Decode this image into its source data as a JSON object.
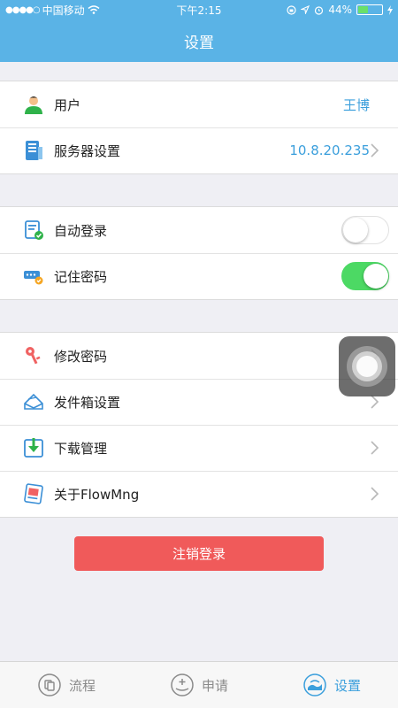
{
  "status_bar": {
    "carrier": "中国移动",
    "time": "下午2:15",
    "battery": "44%",
    "battery_level": 0.44
  },
  "header": {
    "title": "设置"
  },
  "groups": {
    "account": [
      {
        "label": "用户",
        "value": "王博",
        "icon": "user-icon"
      },
      {
        "label": "服务器设置",
        "value": "10.8.20.235",
        "icon": "server-icon"
      }
    ],
    "toggles": [
      {
        "label": "自动登录",
        "on": false,
        "icon": "auto-login-icon"
      },
      {
        "label": "记住密码",
        "on": true,
        "icon": "remember-password-icon"
      }
    ],
    "misc": [
      {
        "label": "修改密码",
        "icon": "key-icon"
      },
      {
        "label": "发件箱设置",
        "icon": "outbox-icon"
      },
      {
        "label": "下载管理",
        "icon": "download-icon"
      },
      {
        "label": "关于FlowMng",
        "icon": "about-icon"
      }
    ]
  },
  "logout_label": "注销登录",
  "tabbar": [
    {
      "label": "流程",
      "icon": "flow-icon",
      "active": false
    },
    {
      "label": "申请",
      "icon": "apply-icon",
      "active": false
    },
    {
      "label": "设置",
      "icon": "settings-icon",
      "active": true
    }
  ],
  "colors": {
    "header": "#5ab3e6",
    "accent": "#3b9fdc",
    "toggle_on": "#4cd964",
    "logout": "#f05a5a"
  }
}
